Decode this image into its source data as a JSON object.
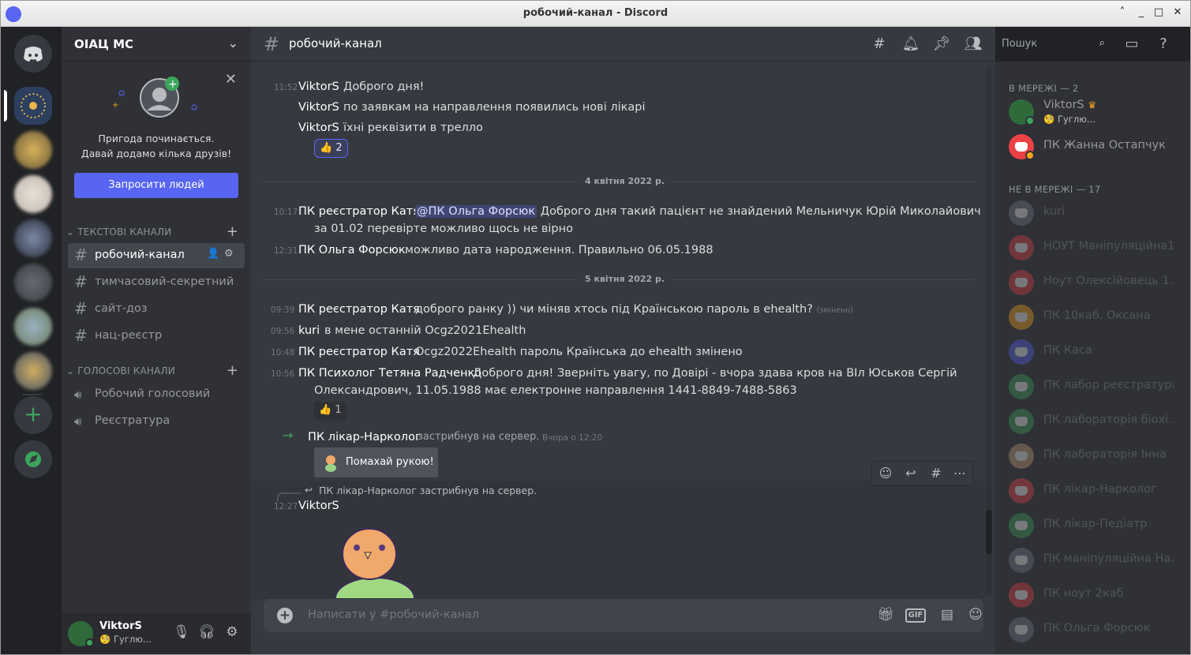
{
  "window": {
    "title": "робочий-канал - Discord"
  },
  "server": {
    "name": "ОІАЦ МС"
  },
  "invite": {
    "line1": "Пригода починається.",
    "line2": "Давай додамо кілька друзів!",
    "button": "Запросити людей"
  },
  "categories": {
    "text": "ТЕКСТОВІ КАНАЛИ",
    "voice": "ГОЛОСОВІ КАНАЛИ"
  },
  "text_channels": [
    {
      "name": "робочий-канал"
    },
    {
      "name": "тимчасовий-секретний"
    },
    {
      "name": "сайт-доз"
    },
    {
      "name": "нац-реєстр"
    }
  ],
  "voice_channels": [
    {
      "name": "Робочий голосовий"
    },
    {
      "name": "Реєстратура"
    }
  ],
  "user": {
    "name": "ViktorS",
    "status": "Гуглю..."
  },
  "channel_header": {
    "title": "робочий-канал",
    "search_placeholder": "Пошук"
  },
  "messages": {
    "m1": {
      "time": "11:52",
      "author": "ViktorS",
      "text": "Доброго дня!"
    },
    "m2": {
      "author": "ViktorS",
      "text": "по заявкам на направлення появились нові лікарі"
    },
    "m3": {
      "author": "ViktorS",
      "text": "їхні реквізити в трелло"
    },
    "r1": {
      "emoji": "👍",
      "count": "2"
    },
    "date1": "4 квітня 2022 р.",
    "m4": {
      "time": "10:17",
      "author": "ПК реєстратор Катя",
      "mention": "@ПК Ольга Форсюк",
      "text": "Доброго дня такий пацієнт не знайдений Мельничук Юрій Миколайович",
      "text2": "за 01.02 перевірте можливо щось не вірно"
    },
    "m5": {
      "time": "12:31",
      "author": "ПК Ольга Форсюк",
      "text": "можливо дата народження. Правильно 06.05.1988"
    },
    "date2": "5 квітня 2022 р.",
    "m6": {
      "time": "09:39",
      "author": "ПК реєстратор Катя",
      "text": "доброго ранку )) чи міняв хтось під Країнською пароль в ehealth?",
      "edited": "(змінено)"
    },
    "m7": {
      "time": "09:56",
      "author": "kuri",
      "text": "в мене останній Ocgz2021Ehealth"
    },
    "m8": {
      "time": "10:48",
      "author": "ПК реєстратор Катя",
      "text": "Ocgz2022Ehealth пароль Країнська до  ehealth змінено"
    },
    "m9": {
      "time": "10:56",
      "author": "ПК Психолог Тетяна Радченко",
      "text": "Доброго дня! Зверніть увагу, по Довірі - вчора здава кров на ВІл Юськов Сергій",
      "text2": "Олександрович, 11.05.1988 має електронне направлення 1441-8849-7488-5863"
    },
    "r2": {
      "emoji": "👍",
      "count": "1"
    },
    "join": {
      "author": "ПК лікар-Нарколог",
      "text": "застрибнув на сервер.",
      "time": "Вчора о 12:20",
      "wave": "Помахай рукою!"
    },
    "reply": {
      "text": "ПК лікар-Нарколог застрибнув на сервер."
    },
    "m10": {
      "time": "12:27",
      "author": "ViktorS"
    }
  },
  "composer": {
    "placeholder": "Написати у #робочий-канал",
    "gif": "GIF"
  },
  "members": {
    "online_label": "В МЕРЕЖІ — 2",
    "offline_label": "НЕ В МЕРЕЖІ — 17",
    "online": [
      {
        "name": "ViktorS",
        "status": "Гуглю..."
      },
      {
        "name": "ПК Жанна Остапчук"
      }
    ],
    "offline": [
      {
        "name": "kuri",
        "color": "#747f8d"
      },
      {
        "name": "НОУТ Маніпуляційна1",
        "color": "#ed4245"
      },
      {
        "name": "Ноут Олексійовець 1...",
        "color": "#ed4245"
      },
      {
        "name": "ПК 10каб. Оксана",
        "color": "#faa61a"
      },
      {
        "name": "ПК Каса",
        "color": "#5865f2"
      },
      {
        "name": "ПК лабор реєстратура",
        "color": "#3ba55c"
      },
      {
        "name": "ПК лабораторія біохі...",
        "color": "#3ba55c"
      },
      {
        "name": "ПК лабораторія Інна",
        "color": "#c9a07a"
      },
      {
        "name": "ПК лікар-Нарколог",
        "color": "#ed4245"
      },
      {
        "name": "ПК лікар-Педіатр",
        "color": "#3ba55c"
      },
      {
        "name": "ПК маніпуляційна На...",
        "color": "#747f8d"
      },
      {
        "name": "ПК ноут 2каб",
        "color": "#ed4245"
      },
      {
        "name": "ПК Ольга Форсюк",
        "color": "#747f8d"
      }
    ]
  },
  "colors": {
    "blurple": "#5865f2",
    "green": "#3ba55c",
    "red": "#ed4245"
  }
}
